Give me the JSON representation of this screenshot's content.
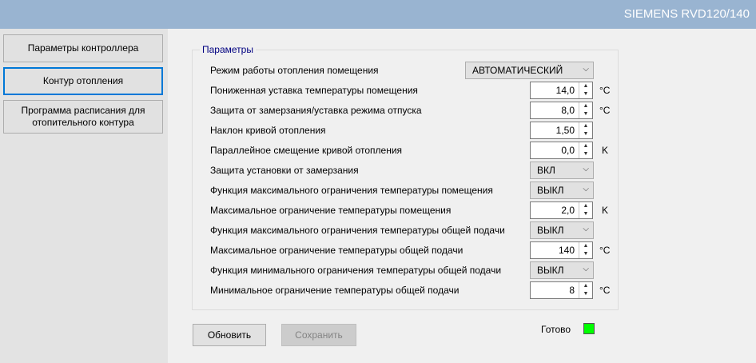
{
  "window": {
    "title": "SIEMENS RVD120/140"
  },
  "sidebar": {
    "items": [
      {
        "label": "Параметры контроллера"
      },
      {
        "label": "Контур отопления",
        "active": true
      },
      {
        "label": "Программа расписания для отопительного контура"
      }
    ]
  },
  "params": {
    "group_title": "Параметры",
    "rows": [
      {
        "label": "Режим работы отопления помещения",
        "type": "select",
        "value": "АВТОМАТИЧЕСКИЙ",
        "unit": ""
      },
      {
        "label": "Пониженная уставка температуры помещения",
        "type": "number",
        "value": "14,0",
        "unit": "°C"
      },
      {
        "label": "Защита от замерзания/уставка режима отпуска",
        "type": "number",
        "value": "8,0",
        "unit": "°C"
      },
      {
        "label": "Наклон кривой отопления",
        "type": "number",
        "value": "1,50",
        "unit": ""
      },
      {
        "label": "Параллейное смещение кривой отопления",
        "type": "number",
        "value": "0,0",
        "unit": "K"
      },
      {
        "label": "Защита установки от замерзания",
        "type": "select",
        "value": "ВКЛ",
        "unit": ""
      },
      {
        "label": "Функция максимального ограничения температуры помещения",
        "type": "select",
        "value": "ВЫКЛ",
        "unit": ""
      },
      {
        "label": "Максимальное ограничение температуры помещения",
        "type": "number",
        "value": "2,0",
        "unit": "K"
      },
      {
        "label": "Функция максимального ограничения температуры общей подачи",
        "type": "select",
        "value": "ВЫКЛ",
        "unit": ""
      },
      {
        "label": "Максимальное ограничение температуры общей подачи",
        "type": "number",
        "value": "140",
        "unit": "°C"
      },
      {
        "label": "Функция минимального ограничения температуры общей подачи",
        "type": "select",
        "value": "ВЫКЛ",
        "unit": ""
      },
      {
        "label": "Минимальное ограничение температуры общей подачи",
        "type": "number",
        "value": "8",
        "unit": "°C"
      }
    ]
  },
  "actions": {
    "refresh_label": "Обновить",
    "save_label": "Сохранить"
  },
  "status": {
    "label": "Готово",
    "color": "#00ff00"
  },
  "colors": {
    "titlebar": "#99b4d1",
    "accent": "#0078d7",
    "legend": "#000080"
  }
}
